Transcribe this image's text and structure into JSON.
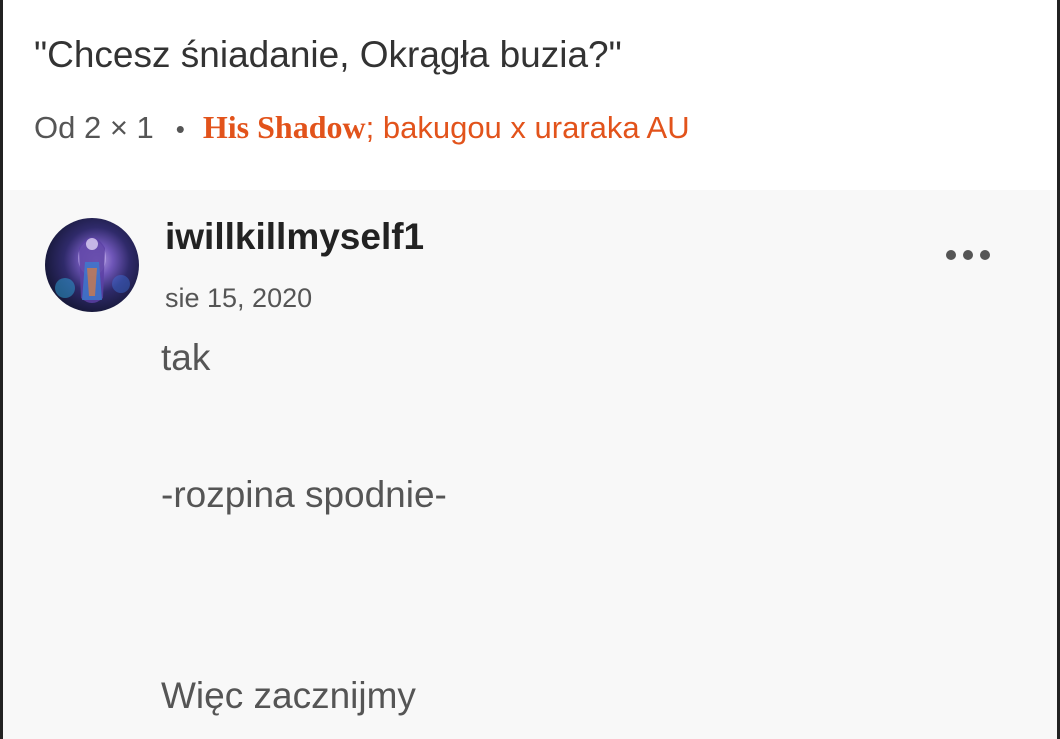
{
  "quote": {
    "text": "\"Chcesz śniadanie, Okrągła buzia?\""
  },
  "source": {
    "prefix": "Od 2 × 1",
    "separator": "•",
    "story_title": "His Shadow",
    "story_subtitle": "; bakugou x uraraka AU",
    "accent_color": "#e2531b"
  },
  "comment": {
    "author": "iwillkillmyself1",
    "date": "sie 15, 2020",
    "menu_icon": "more-horizontal-icon",
    "lines": [
      "tak",
      "-rozpina spodnie-",
      "Więc zacznijmy"
    ]
  }
}
